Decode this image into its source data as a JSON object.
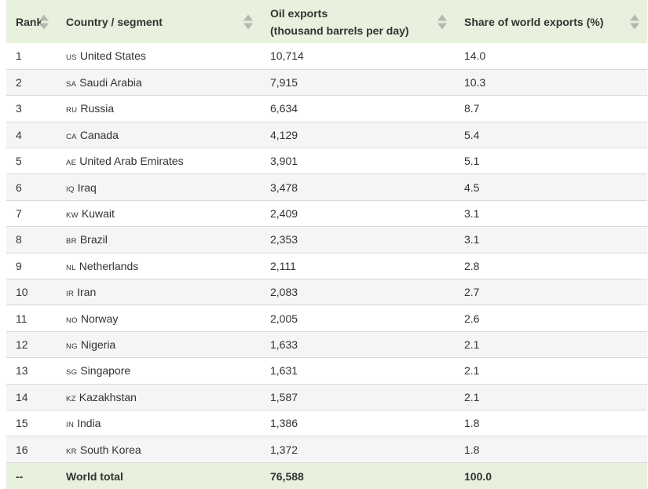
{
  "header": {
    "rank": "Rank",
    "country": "Country / segment",
    "exports_line1": "Oil exports",
    "exports_line2": "(thousand barrels per day)",
    "share": "Share of world exports (%)"
  },
  "rows": [
    {
      "rank": "1",
      "code": "US",
      "country": "United States",
      "exports": "10,714",
      "share": "14.0"
    },
    {
      "rank": "2",
      "code": "SA",
      "country": "Saudi Arabia",
      "exports": "7,915",
      "share": "10.3"
    },
    {
      "rank": "3",
      "code": "RU",
      "country": "Russia",
      "exports": "6,634",
      "share": "8.7"
    },
    {
      "rank": "4",
      "code": "CA",
      "country": "Canada",
      "exports": "4,129",
      "share": "5.4"
    },
    {
      "rank": "5",
      "code": "AE",
      "country": "United Arab Emirates",
      "exports": "3,901",
      "share": "5.1"
    },
    {
      "rank": "6",
      "code": "IQ",
      "country": "Iraq",
      "exports": "3,478",
      "share": "4.5"
    },
    {
      "rank": "7",
      "code": "KW",
      "country": "Kuwait",
      "exports": "2,409",
      "share": "3.1"
    },
    {
      "rank": "8",
      "code": "BR",
      "country": "Brazil",
      "exports": "2,353",
      "share": "3.1"
    },
    {
      "rank": "9",
      "code": "NL",
      "country": "Netherlands",
      "exports": "2,111",
      "share": "2.8"
    },
    {
      "rank": "10",
      "code": "IR",
      "country": "Iran",
      "exports": "2,083",
      "share": "2.7"
    },
    {
      "rank": "11",
      "code": "NO",
      "country": "Norway",
      "exports": "2,005",
      "share": "2.6"
    },
    {
      "rank": "12",
      "code": "NG",
      "country": "Nigeria",
      "exports": "1,633",
      "share": "2.1"
    },
    {
      "rank": "13",
      "code": "SG",
      "country": "Singapore",
      "exports": "1,631",
      "share": "2.1"
    },
    {
      "rank": "14",
      "code": "KZ",
      "country": "Kazakhstan",
      "exports": "1,587",
      "share": "2.1"
    },
    {
      "rank": "15",
      "code": "IN",
      "country": "India",
      "exports": "1,386",
      "share": "1.8"
    },
    {
      "rank": "16",
      "code": "KR",
      "country": "South Korea",
      "exports": "1,372",
      "share": "1.8"
    }
  ],
  "footer": {
    "rank": "--",
    "country": "World total",
    "exports": "76,588",
    "share": "100.0"
  },
  "colors": {
    "header_bg": "#e8f1dd",
    "row_alt_bg": "#f5f5f5",
    "border": "#d9d9d9"
  }
}
